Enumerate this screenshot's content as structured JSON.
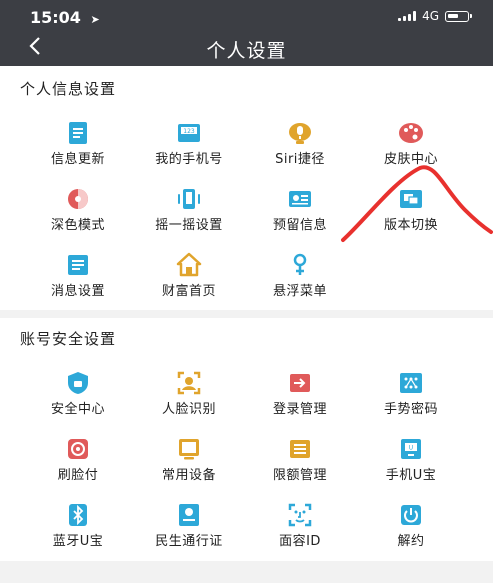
{
  "status_bar": {
    "time": "15:04",
    "network": "4G"
  },
  "header": {
    "title": "个人设置"
  },
  "sections": [
    {
      "title": "个人信息设置",
      "items": [
        {
          "label": "信息更新",
          "icon": "document-update-icon",
          "color": "#2da8d8"
        },
        {
          "label": "我的手机号",
          "icon": "phone-number-icon",
          "color": "#2da8d8"
        },
        {
          "label": "Siri捷径",
          "icon": "siri-shortcut-icon",
          "color": "#e0a42c"
        },
        {
          "label": "皮肤中心",
          "icon": "palette-icon",
          "color": "#e05a5a"
        },
        {
          "label": "深色模式",
          "icon": "dark-mode-icon",
          "color": "#e05a5a"
        },
        {
          "label": "摇一摇设置",
          "icon": "shake-phone-icon",
          "color": "#2da8d8"
        },
        {
          "label": "预留信息",
          "icon": "reserved-info-card-icon",
          "color": "#2da8d8"
        },
        {
          "label": "版本切换",
          "icon": "version-switch-icon",
          "color": "#2da8d8"
        },
        {
          "label": "消息设置",
          "icon": "message-settings-icon",
          "color": "#2da8d8"
        },
        {
          "label": "财富首页",
          "icon": "wealth-home-icon",
          "color": "#e0a42c"
        },
        {
          "label": "悬浮菜单",
          "icon": "floating-menu-icon",
          "color": "#2da8d8"
        }
      ]
    },
    {
      "title": "账号安全设置",
      "items": [
        {
          "label": "安全中心",
          "icon": "security-shield-icon",
          "color": "#2da8d8"
        },
        {
          "label": "人脸识别",
          "icon": "face-recognition-icon",
          "color": "#e0a42c"
        },
        {
          "label": "登录管理",
          "icon": "login-management-icon",
          "color": "#e05a5a"
        },
        {
          "label": "手势密码",
          "icon": "gesture-password-icon",
          "color": "#2da8d8"
        },
        {
          "label": "刷脸付",
          "icon": "face-pay-icon",
          "color": "#e05a5a"
        },
        {
          "label": "常用设备",
          "icon": "common-device-icon",
          "color": "#e0a42c"
        },
        {
          "label": "限额管理",
          "icon": "limit-management-icon",
          "color": "#e0a42c"
        },
        {
          "label": "手机U宝",
          "icon": "phone-ukey-icon",
          "color": "#2da8d8"
        },
        {
          "label": "蓝牙U宝",
          "icon": "bluetooth-ukey-icon",
          "color": "#2da8d8"
        },
        {
          "label": "民生通行证",
          "icon": "pass-card-icon",
          "color": "#2da8d8"
        },
        {
          "label": "面容ID",
          "icon": "face-id-icon",
          "color": "#2da8d8"
        },
        {
          "label": "解约",
          "icon": "power-cancel-icon",
          "color": "#2da8d8"
        }
      ]
    }
  ],
  "colors": {
    "header_bg": "#3c3e44",
    "blue": "#2da8d8",
    "orange": "#e0a42c",
    "red": "#e05a5a",
    "annotation": "#e8312e"
  }
}
